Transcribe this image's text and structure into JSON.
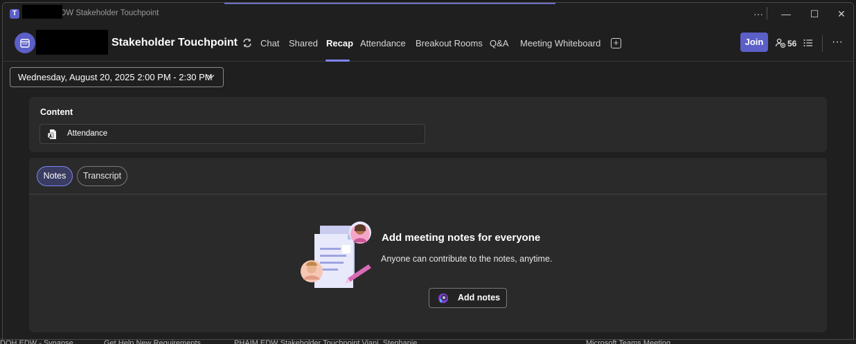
{
  "window": {
    "title": "DW Stakeholder Touchpoint",
    "controls": {
      "more": "···",
      "minimize": "—",
      "maximize": "☐",
      "close": "✕"
    }
  },
  "header": {
    "meeting_title": "Stakeholder Touchpoint",
    "tabs": [
      {
        "label": "Chat",
        "active": false
      },
      {
        "label": "Shared",
        "active": false
      },
      {
        "label": "Recap",
        "active": true
      },
      {
        "label": "Attendance",
        "active": false
      },
      {
        "label": "Breakout Rooms",
        "active": false
      },
      {
        "label": "Q&A",
        "active": false
      },
      {
        "label": "Meeting Whiteboard",
        "active": false
      }
    ],
    "join_label": "Join",
    "participant_count": "56",
    "more_label": "···"
  },
  "recap": {
    "date_range": "Wednesday, August 20, 2025 2:00 PM - 2:30 PM",
    "content": {
      "heading": "Content",
      "items": [
        {
          "label": "Attendance",
          "icon": "attendance-report-icon"
        }
      ]
    },
    "notes": {
      "pills": [
        {
          "label": "Notes",
          "active": true
        },
        {
          "label": "Transcript",
          "active": false
        }
      ],
      "heading": "Add meeting notes for everyone",
      "subtext": "Anyone can contribute to the notes, anytime.",
      "add_button": "Add notes"
    }
  },
  "background_windows": [
    {
      "label": "DOH EDW - Synapse"
    },
    {
      "label": "Get Help New Requirements"
    },
    {
      "label": "PHAIM EDW Stakeholder Touchpoint Viani, Stephanie"
    },
    {
      "label": "Microsoft Teams Meeting"
    }
  ],
  "colors": {
    "accent": "#5b5fc7",
    "accent_light": "#7f85f5",
    "background": "#1f1f1f",
    "panel": "#2a2a2a"
  }
}
